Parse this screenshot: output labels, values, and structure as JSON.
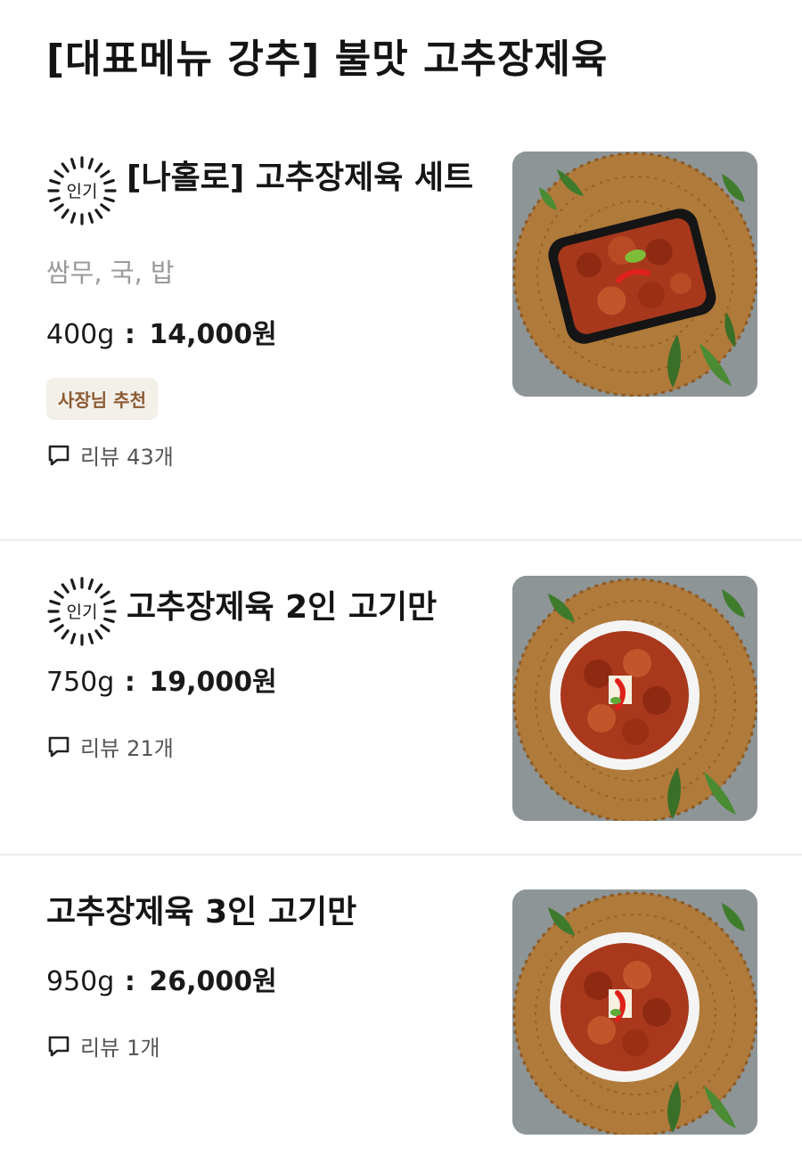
{
  "section": {
    "title": "[대표메뉴 강추] 불맛 고추장제육"
  },
  "popular_badge_label": "인기",
  "colors": {
    "owner_badge_bg": "#f3efe9",
    "owner_badge_text": "#8a5b34",
    "description_gray": "#9a9a9a",
    "divider": "#ededed"
  },
  "items": [
    {
      "name": "[나홀로] 고추장제육 세트",
      "popular": true,
      "description": "쌈무, 국, 밥",
      "weight": "400g",
      "price_separator": ":",
      "price": "14,000원",
      "owner_badge": "사장님 추천",
      "review_label": "리뷰",
      "review_count": "43개",
      "icon": "comment-icon",
      "image": "food-photo-black-container"
    },
    {
      "name": "고추장제육 2인 고기만",
      "popular": true,
      "weight": "750g",
      "price_separator": ":",
      "price": "19,000원",
      "review_label": "리뷰",
      "review_count": "21개",
      "icon": "comment-icon",
      "image": "food-photo-white-bowl"
    },
    {
      "name": "고추장제육 3인 고기만",
      "popular": false,
      "weight": "950g",
      "price_separator": ":",
      "price": "26,000원",
      "review_label": "리뷰",
      "review_count": "1개",
      "icon": "comment-icon",
      "image": "food-photo-white-bowl"
    }
  ]
}
